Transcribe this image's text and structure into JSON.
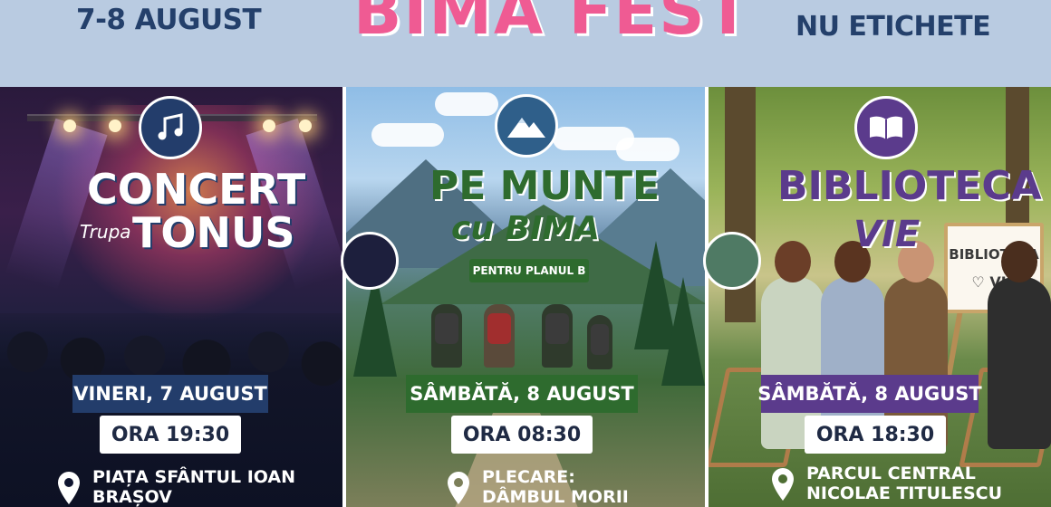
{
  "banner": {
    "date": "7-8 AUGUST",
    "title": "BIMA FEST",
    "tag": "NU ETICHETE"
  },
  "panels": [
    {
      "icon": "music-note-icon",
      "title_line1": "CONCERT",
      "title_small": "Trupa",
      "title_line2": "TONUS",
      "day": "VINERI, 7 AUGUST",
      "time": "ORA 19:30",
      "location_line1": "PIAȚA SFÂNTUL IOAN",
      "location_line2": "BRAȘOV"
    },
    {
      "icon": "mountain-icon",
      "title_line1": "PE MUNTE",
      "title_small": "cu BIMA",
      "badge": "PENTRU PLANUL B",
      "day": "SÂMBĂTĂ, 8 AUGUST",
      "time": "ORA 08:30",
      "location_line1": "PLECARE:",
      "location_line2": "DÂMBUL MORII"
    },
    {
      "icon": "open-book-icon",
      "title_line1": "BIBLIOTECA",
      "title_small": "VIE",
      "easel_line1": "BIBLIOTECA",
      "easel_line2": "♡ VIE",
      "day": "SÂMBĂTĂ, 8 AUGUST",
      "time": "ORA 18:30",
      "location_line1": "PARCUL CENTRAL",
      "location_line2": "NICOLAE TITULESCU"
    }
  ],
  "colors": {
    "banner_bg": "#b9cbe1",
    "banner_text": "#24406b",
    "title_pink": "#ef5b93",
    "concert_accent": "#233d6b",
    "mountain_accent": "#2e6b2e",
    "library_accent": "#5b3b8c"
  }
}
